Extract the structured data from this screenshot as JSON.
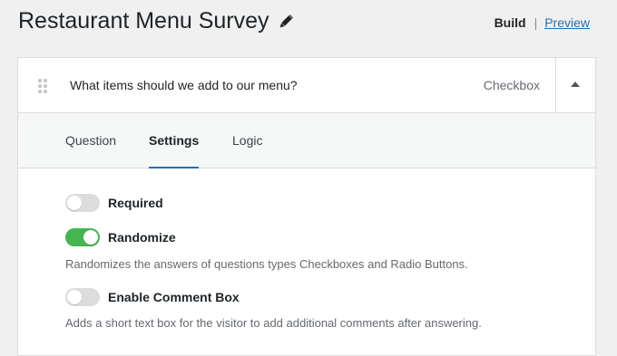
{
  "header": {
    "title": "Restaurant Menu Survey",
    "edit_icon": "pencil-icon",
    "nav": {
      "build": "Build",
      "separator": "|",
      "preview": "Preview"
    }
  },
  "question": {
    "text": "What items should we add to our menu?",
    "type": "Checkbox",
    "drag_icon": "drag-handle-icon",
    "collapse_icon": "caret-up-icon"
  },
  "tabs": [
    {
      "label": "Question",
      "active": false
    },
    {
      "label": "Settings",
      "active": true
    },
    {
      "label": "Logic",
      "active": false
    }
  ],
  "settings": [
    {
      "label": "Required",
      "enabled": false
    },
    {
      "label": "Randomize",
      "enabled": true,
      "description": "Randomizes the answers of questions types Checkboxes and Radio Buttons."
    },
    {
      "label": "Enable Comment Box",
      "enabled": false,
      "description": "Adds a short text box for the visitor to add additional comments after answering."
    }
  ],
  "colors": {
    "accent": "#2271b1",
    "toggle_on": "#46b450",
    "toggle_off": "#dcdcde",
    "background": "#f0f0f1"
  }
}
